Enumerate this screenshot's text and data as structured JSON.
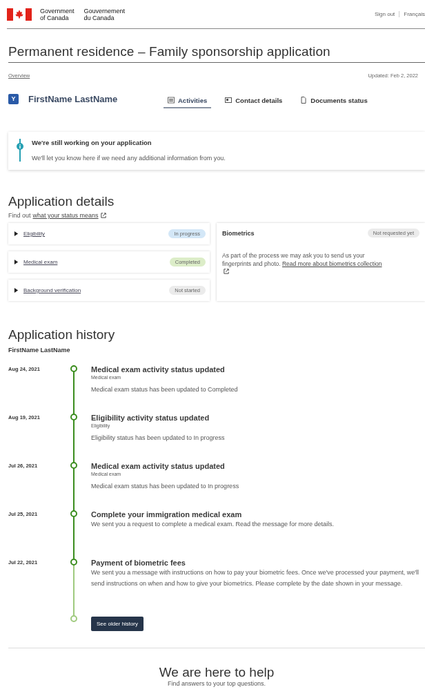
{
  "header": {
    "gov_en": [
      "Government",
      "of Canada"
    ],
    "gov_fr": [
      "Gouvernement",
      "du Canada"
    ],
    "links": [
      "Sign out",
      "Français"
    ]
  },
  "title": "Permanent residence – Family sponsorship application",
  "breadcrumb": "Overview",
  "updated": "Updated: Feb 2, 2022",
  "profile": {
    "initial": "Y",
    "name": "FirstName LastName"
  },
  "tabs": [
    {
      "label": "Activities",
      "selected": true
    },
    {
      "label": "Contact details",
      "selected": false
    },
    {
      "label": "Documents status",
      "selected": false
    }
  ],
  "notice": {
    "title": "We're still working on your application",
    "text": "We'll let you know here if we need any additional information from you."
  },
  "details": {
    "heading": "Application details",
    "intro": "Find out",
    "intro_link": "what your status means",
    "items": [
      {
        "label": "Eligibility",
        "status": "In progress",
        "color": "#d3e7f7",
        "expanded": false
      },
      {
        "label": "Medical exam",
        "status": "Completed",
        "color": "#dcedc8",
        "expanded": false
      },
      {
        "label": "Background verification",
        "status": "Not started",
        "color": "#ebebeb",
        "expanded": false
      }
    ],
    "biometrics": {
      "title": "Biometrics",
      "status": "Not requested yet",
      "color": "#ebebeb",
      "text": "As part of the process we may ask you to send us your fingerprints and photo.",
      "link": "Read more about biometrics collection"
    }
  },
  "history": {
    "heading": "Application history",
    "name": "FirstName LastName",
    "entries": [
      {
        "date": "Aug 24, 2021",
        "title": "Medical exam activity status updated",
        "category": "Medical exam",
        "text": "Medical exam status has been updated to Completed"
      },
      {
        "date": "Aug 19, 2021",
        "title": "Eligibility activity status updated",
        "category": "Eligibility",
        "text": "Eligibility status has been updated to In progress"
      },
      {
        "date": "Jul 26, 2021",
        "title": "Medical exam activity status updated",
        "category": "Medical exam",
        "text": "Medical exam status has been updated to In progress"
      },
      {
        "date": "Jul 25, 2021",
        "title": "Complete your immigration medical exam",
        "text": "We sent you a request to complete a medical exam. Read the message for more details."
      },
      {
        "date": "Jul 22, 2021",
        "title": "Payment of biometric fees",
        "text": "We sent you a message with instructions on how to pay your biometric fees. Once we've processed your payment, we'll send instructions on when and how to give your biometrics. Please complete by the date shown in your message."
      }
    ],
    "button": "See older history"
  },
  "help": {
    "heading": "We are here to help",
    "text": "Find answers to your top questions."
  }
}
